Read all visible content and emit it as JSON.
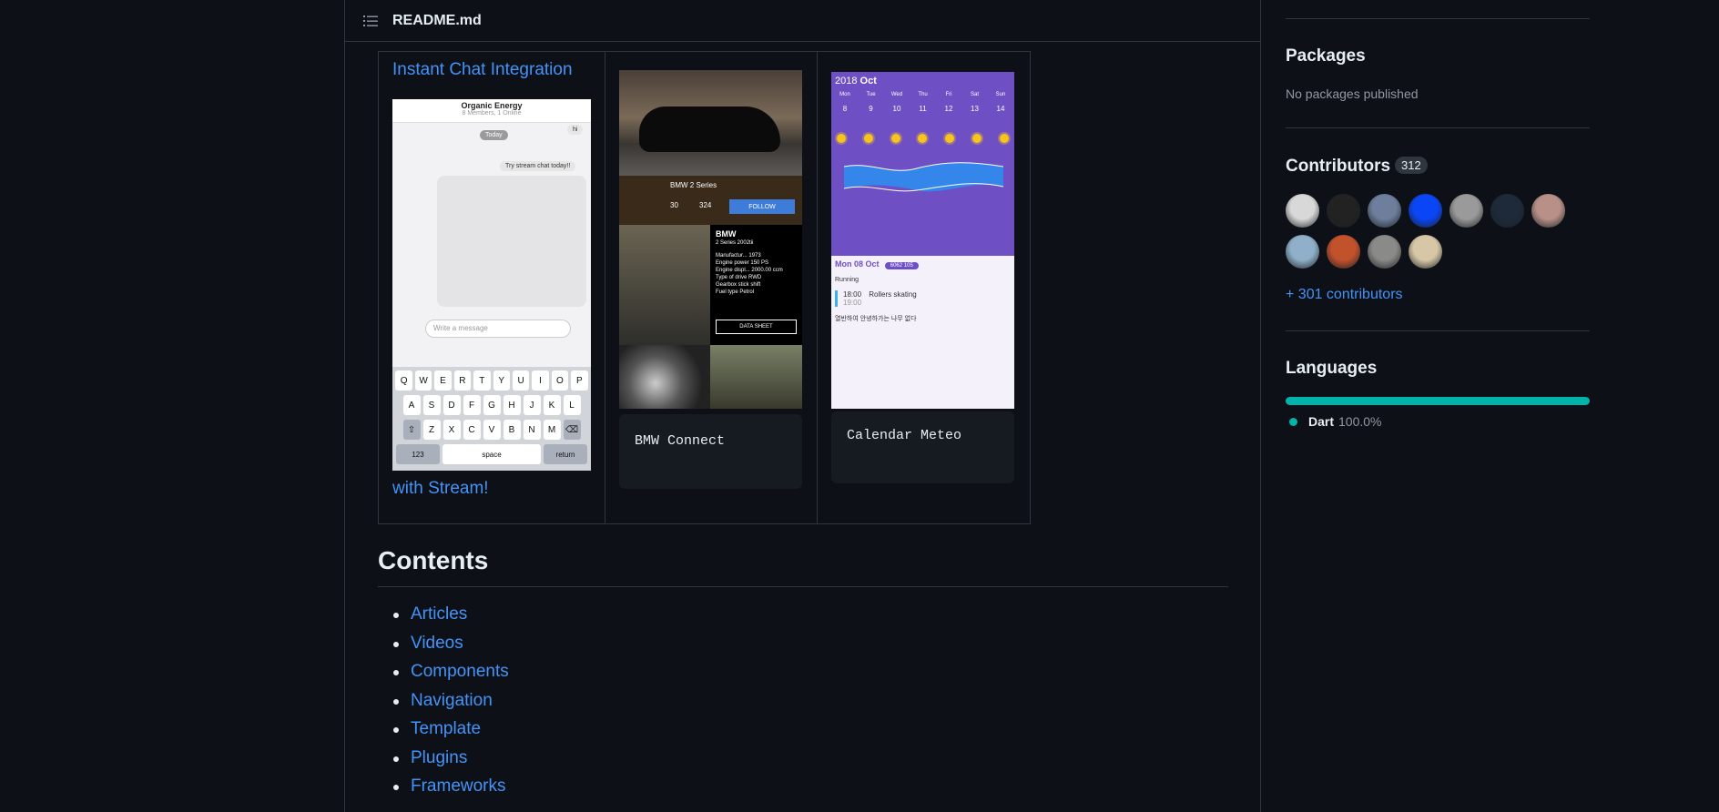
{
  "readme": {
    "title": "README.md"
  },
  "showcase": {
    "chat": {
      "link_top": "Instant Chat Integration",
      "link_bottom": "with Stream!",
      "app_title": "Organic Energy",
      "app_sub": "8 Members, 1 Online",
      "today": "Today",
      "msg1": "hi",
      "msg2": "Try stream chat today!!",
      "input_placeholder": "Write a message",
      "kb_row1": [
        "Q",
        "W",
        "E",
        "R",
        "T",
        "Y",
        "U",
        "I",
        "O",
        "P"
      ],
      "kb_row2": [
        "A",
        "S",
        "D",
        "F",
        "G",
        "H",
        "J",
        "K",
        "L"
      ],
      "kb_row3": [
        "Z",
        "X",
        "C",
        "V",
        "B",
        "N",
        "M"
      ],
      "kb_123": "123",
      "kb_space": "space",
      "kb_return": "return"
    },
    "bmw": {
      "model": "BMW 2 Series",
      "follow": "FOLLOW",
      "stat1": "30",
      "stat2": "324",
      "spec_title": "BMW",
      "spec_sub": "2 Series 2002tii",
      "specs": [
        "Manufactur... 1973",
        "Engine power 150 PS",
        "Engine displ... 2000.00 ccm",
        "Type of drive RWD",
        "Gearbox stick shift",
        "Fuel type Petrol"
      ],
      "datasheet": "DATA SHEET",
      "caption": "BMW Connect"
    },
    "calendar": {
      "year": "2018",
      "month": "Oct",
      "days": [
        "Mon",
        "Tue",
        "Wed",
        "Thu",
        "Fri",
        "Sat",
        "Sun"
      ],
      "nums": [
        "8",
        "9",
        "10",
        "11",
        "12",
        "13",
        "14"
      ],
      "date_label": "Mon 08 Oct",
      "pill": "6062 105",
      "running": "Running",
      "event_time": "18:00",
      "event_name": "Rollers skating",
      "event_end": "19:00",
      "note": "열반하여 안녕하가는 나무 없다",
      "caption": "Calendar Meteo"
    }
  },
  "contents": {
    "heading": "Contents",
    "items": [
      "Articles",
      "Videos",
      "Components",
      "Navigation",
      "Template",
      "Plugins",
      "Frameworks"
    ]
  },
  "sidebar": {
    "packages": {
      "heading": "Packages",
      "text": "No packages published"
    },
    "contributors": {
      "heading": "Contributors",
      "count": "312",
      "more": "+ 301 contributors",
      "avatar_colors": [
        "#d8d8d8",
        "#222222",
        "#6d7f9c",
        "#0a46f5",
        "#9a9a9a",
        "#1e2a3a",
        "#b99088",
        "#8fb0c8",
        "#c2522c",
        "#8a8a88",
        "#d7c7a6"
      ]
    },
    "languages": {
      "heading": "Languages",
      "name": "Dart",
      "percent": "100.0%",
      "color": "#00b4ab"
    }
  }
}
